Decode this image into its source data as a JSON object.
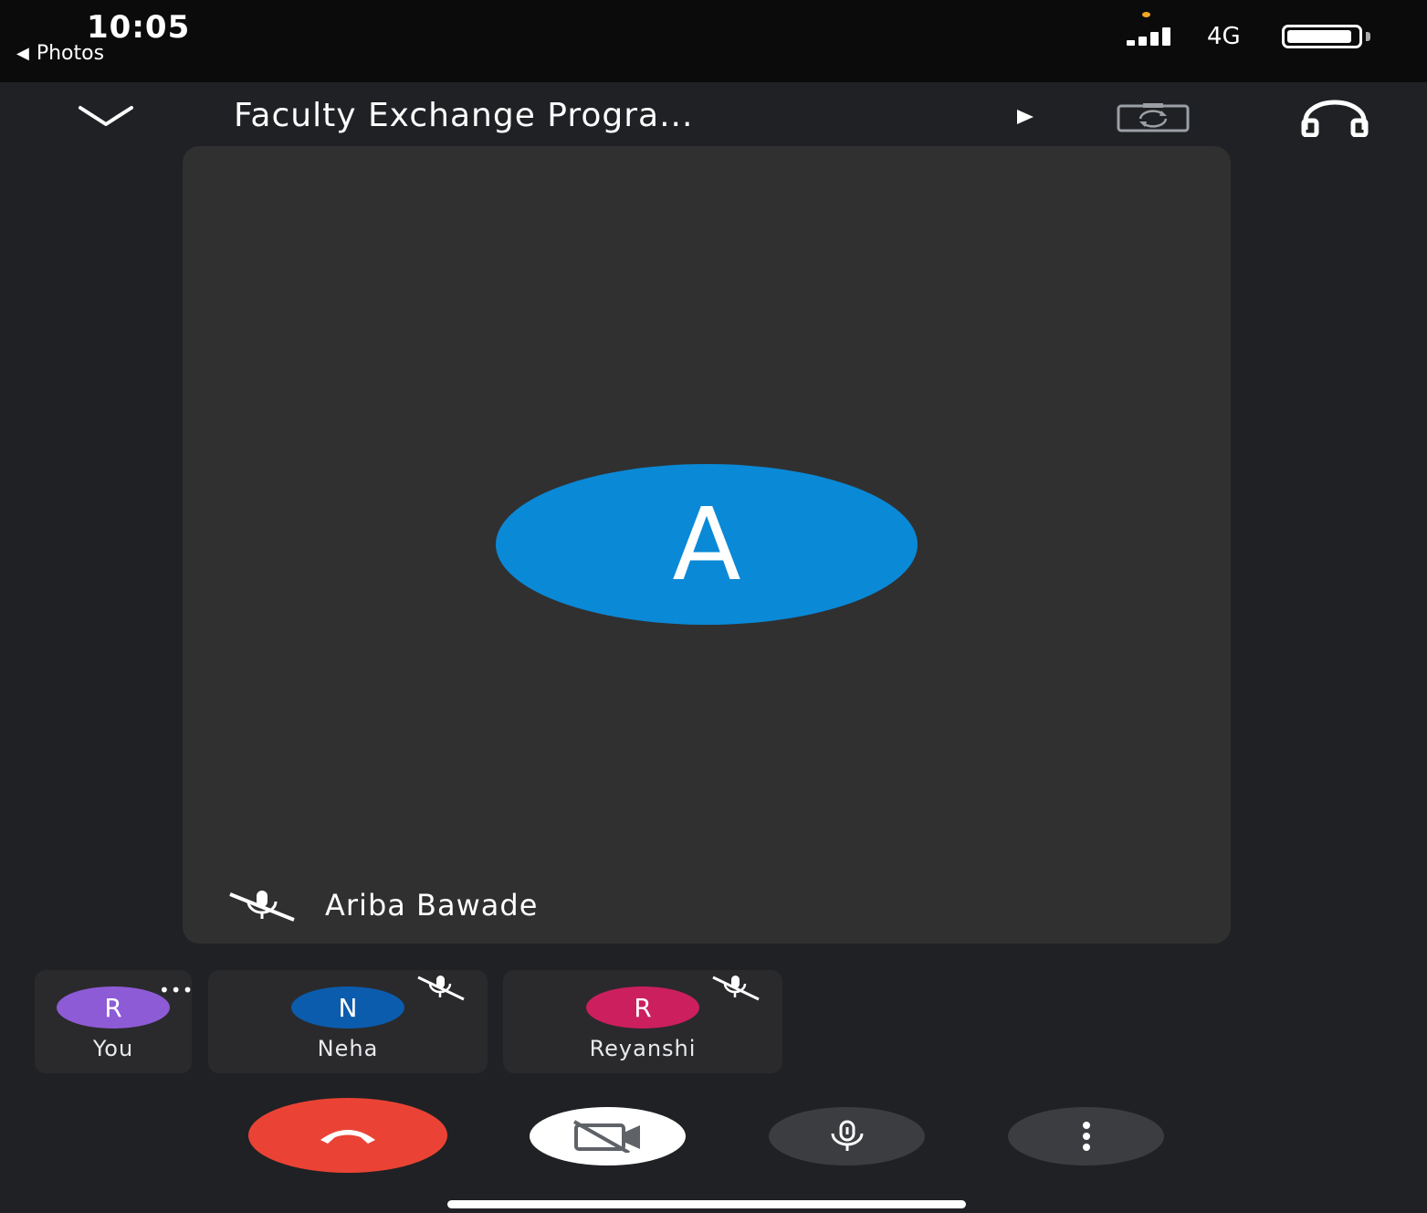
{
  "status_bar": {
    "time": "10:05",
    "back_app": "Photos",
    "network": "4G",
    "battery_level": 0.92
  },
  "topbar": {
    "meeting_title": "Faculty Exchange Progra..."
  },
  "main_tile": {
    "avatar_letter": "A",
    "speaker_name": "Ariba Bawade",
    "avatar_color": "#0a89d6"
  },
  "participants": [
    {
      "initial": "R",
      "name": "You",
      "color": "#8e5bd6",
      "muted": false
    },
    {
      "initial": "N",
      "name": "Neha",
      "color": "#0b5cad",
      "muted": true
    },
    {
      "initial": "R",
      "name": "Reyanshi",
      "color": "#cc1f5d",
      "muted": true
    }
  ],
  "colors": {
    "background": "#202124",
    "tile": "#303031",
    "end_call": "#ea4335"
  }
}
